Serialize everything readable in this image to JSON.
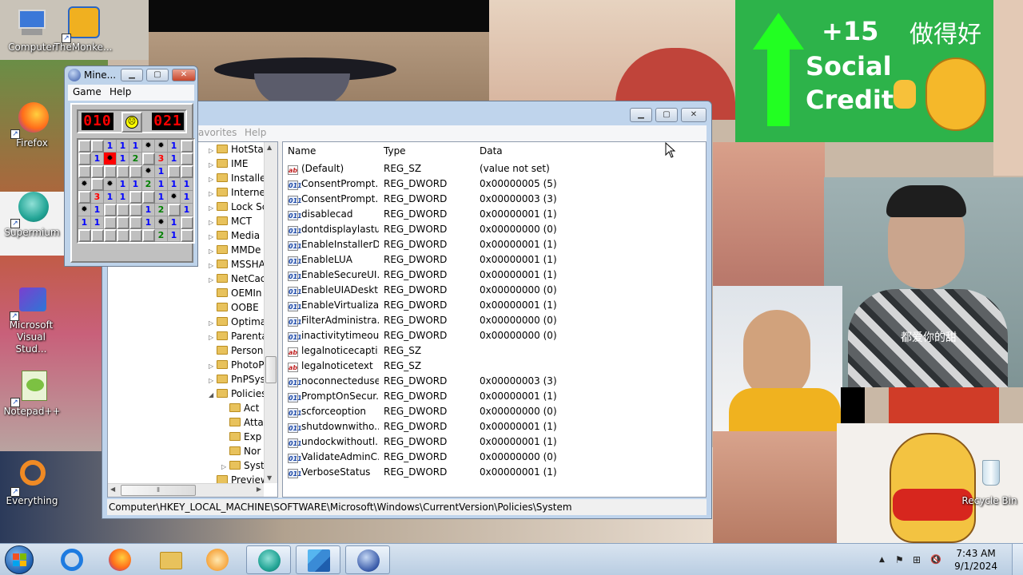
{
  "desktop": {
    "icons": [
      {
        "label": "Computer"
      },
      {
        "label": "TheMonke..."
      },
      {
        "label": "Firefox"
      },
      {
        "label": "Supermium"
      },
      {
        "label": "Microsoft Visual Stud..."
      },
      {
        "label": "Notepad++"
      },
      {
        "label": "Everything"
      },
      {
        "label": "Recycle Bin"
      }
    ],
    "wallpaper": {
      "plus": "+15",
      "social": "Social",
      "credit": "Credit",
      "chinese": "做得好",
      "subtitle": "都爱你的甜",
      "accent": "#2db34a"
    }
  },
  "regedit": {
    "menu": {
      "favorites": "avorites",
      "help": "Help"
    },
    "caption_buttons": {
      "minimize": "▁",
      "maximize": "▢",
      "close": "✕"
    },
    "tree": [
      {
        "label": "HotSta",
        "expander": "▷",
        "level": 0
      },
      {
        "label": "IME",
        "expander": "▷",
        "level": 0
      },
      {
        "label": "Installe",
        "expander": "▷",
        "level": 0
      },
      {
        "label": "Interne",
        "expander": "▷",
        "level": 0
      },
      {
        "label": "Lock Sc",
        "expander": "▷",
        "level": 0
      },
      {
        "label": "MCT",
        "expander": "▷",
        "level": 0
      },
      {
        "label": "Media",
        "expander": "▷",
        "level": 0
      },
      {
        "label": "MMDe",
        "expander": "▷",
        "level": 0
      },
      {
        "label": "MSSHA",
        "expander": "▷",
        "level": 0
      },
      {
        "label": "NetCac",
        "expander": "▷",
        "level": 0
      },
      {
        "label": "OEMIn",
        "expander": "",
        "level": 0
      },
      {
        "label": "OOBE",
        "expander": "",
        "level": 0
      },
      {
        "label": "Optima",
        "expander": "▷",
        "level": 0
      },
      {
        "label": "Parenta",
        "expander": "▷",
        "level": 0
      },
      {
        "label": "Person",
        "expander": "",
        "level": 0
      },
      {
        "label": "PhotoP",
        "expander": "▷",
        "level": 0
      },
      {
        "label": "PnPSys",
        "expander": "▷",
        "level": 0
      },
      {
        "label": "Policies",
        "expander": "◢",
        "level": 0
      },
      {
        "label": "Act",
        "expander": "",
        "level": 1
      },
      {
        "label": "Atta",
        "expander": "",
        "level": 1
      },
      {
        "label": "Exp",
        "expander": "",
        "level": 1
      },
      {
        "label": "Nor",
        "expander": "",
        "level": 1
      },
      {
        "label": "Syst",
        "expander": "▷",
        "level": 1
      },
      {
        "label": "Preview",
        "expander": "",
        "level": 0
      }
    ],
    "scroll_arrows": {
      "up": "▲",
      "down": "▼",
      "left": "◀",
      "right": "▶",
      "grip": "⦀"
    },
    "columns": {
      "name": "Name",
      "type": "Type",
      "data": "Data"
    },
    "values": [
      {
        "icon": "ab",
        "kind": "sz",
        "name": "(Default)",
        "type": "REG_SZ",
        "data": "(value not set)"
      },
      {
        "icon": "011",
        "kind": "dw",
        "name": "ConsentPrompt...",
        "type": "REG_DWORD",
        "data": "0x00000005 (5)"
      },
      {
        "icon": "011",
        "kind": "dw",
        "name": "ConsentPrompt...",
        "type": "REG_DWORD",
        "data": "0x00000003 (3)"
      },
      {
        "icon": "011",
        "kind": "dw",
        "name": "disablecad",
        "type": "REG_DWORD",
        "data": "0x00000001 (1)"
      },
      {
        "icon": "011",
        "kind": "dw",
        "name": "dontdisplaylastu...",
        "type": "REG_DWORD",
        "data": "0x00000000 (0)"
      },
      {
        "icon": "011",
        "kind": "dw",
        "name": "EnableInstallerD...",
        "type": "REG_DWORD",
        "data": "0x00000001 (1)"
      },
      {
        "icon": "011",
        "kind": "dw",
        "name": "EnableLUA",
        "type": "REG_DWORD",
        "data": "0x00000001 (1)"
      },
      {
        "icon": "011",
        "kind": "dw",
        "name": "EnableSecureUI...",
        "type": "REG_DWORD",
        "data": "0x00000001 (1)"
      },
      {
        "icon": "011",
        "kind": "dw",
        "name": "EnableUIADeskt...",
        "type": "REG_DWORD",
        "data": "0x00000000 (0)"
      },
      {
        "icon": "011",
        "kind": "dw",
        "name": "EnableVirtualizat...",
        "type": "REG_DWORD",
        "data": "0x00000001 (1)"
      },
      {
        "icon": "011",
        "kind": "dw",
        "name": "FilterAdministra...",
        "type": "REG_DWORD",
        "data": "0x00000000 (0)"
      },
      {
        "icon": "011",
        "kind": "dw",
        "name": "inactivitytimeou...",
        "type": "REG_DWORD",
        "data": "0x00000000 (0)"
      },
      {
        "icon": "ab",
        "kind": "sz",
        "name": "legalnoticecapti...",
        "type": "REG_SZ",
        "data": ""
      },
      {
        "icon": "ab",
        "kind": "sz",
        "name": "legalnoticetext",
        "type": "REG_SZ",
        "data": ""
      },
      {
        "icon": "011",
        "kind": "dw",
        "name": "noconnecteduser",
        "type": "REG_DWORD",
        "data": "0x00000003 (3)"
      },
      {
        "icon": "011",
        "kind": "dw",
        "name": "PromptOnSecur...",
        "type": "REG_DWORD",
        "data": "0x00000001 (1)"
      },
      {
        "icon": "011",
        "kind": "dw",
        "name": "scforceoption",
        "type": "REG_DWORD",
        "data": "0x00000000 (0)"
      },
      {
        "icon": "011",
        "kind": "dw",
        "name": "shutdownwitho...",
        "type": "REG_DWORD",
        "data": "0x00000001 (1)"
      },
      {
        "icon": "011",
        "kind": "dw",
        "name": "undockwithoutl...",
        "type": "REG_DWORD",
        "data": "0x00000001 (1)"
      },
      {
        "icon": "011",
        "kind": "dw",
        "name": "ValidateAdminC...",
        "type": "REG_DWORD",
        "data": "0x00000000 (0)"
      },
      {
        "icon": "011",
        "kind": "dw",
        "name": "VerboseStatus",
        "type": "REG_DWORD",
        "data": "0x00000001 (1)"
      }
    ],
    "status_path": "Computer\\HKEY_LOCAL_MACHINE\\SOFTWARE\\Microsoft\\Windows\\CurrentVersion\\Policies\\System"
  },
  "minesweeper": {
    "title": "Mine...",
    "menu": {
      "game": "Game",
      "help": "Help"
    },
    "caption_buttons": {
      "minimize": "▁",
      "maximize": "▢",
      "close": "✕"
    },
    "mines_left": "010",
    "timer": "021",
    "face": "☹",
    "grid": [
      [
        "u",
        "u",
        "1",
        "1",
        "1",
        "m",
        "m",
        "1",
        "u"
      ],
      [
        "u",
        "1",
        "x",
        "1",
        "2",
        "u",
        "3",
        "1",
        "u"
      ],
      [
        "u",
        "u",
        "u",
        "u",
        "u",
        "m",
        "1",
        "u",
        "u"
      ],
      [
        "m",
        "u",
        "m",
        "1",
        "1",
        "2",
        "1",
        "1",
        "1"
      ],
      [
        "u",
        "3",
        "1",
        "1",
        "u",
        "u",
        "1",
        "m",
        "1"
      ],
      [
        "m",
        "1",
        "u",
        "u",
        "u",
        "1",
        "2",
        "u",
        "1"
      ],
      [
        "1",
        "1",
        "u",
        "u",
        "u",
        "1",
        "m",
        "1",
        "u"
      ],
      [
        "u",
        "u",
        "u",
        "u",
        "u",
        "u",
        "2",
        "1",
        "u"
      ]
    ],
    "mine_glyph": "✹"
  },
  "taskbar": {
    "time": "7:43 AM",
    "date": "9/1/2024",
    "tray_glyphs": {
      "arrow": "▲",
      "flag": "⚑",
      "network": "⊞",
      "volume": "🔇"
    }
  }
}
